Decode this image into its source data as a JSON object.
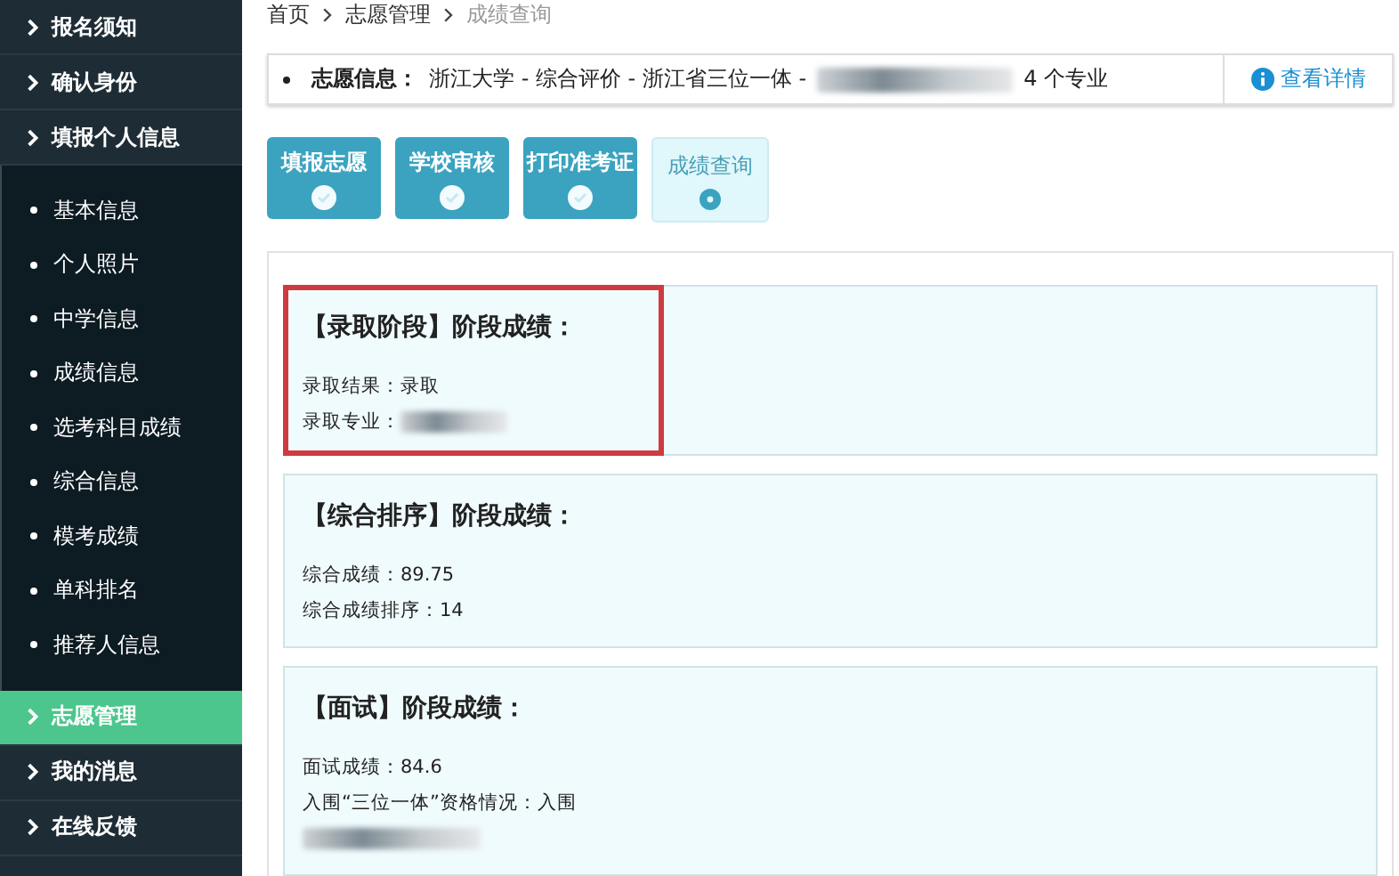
{
  "sidebar": {
    "items": [
      {
        "label": "报名须知",
        "kind": "section",
        "selected": false
      },
      {
        "label": "确认身份",
        "kind": "section",
        "selected": false
      },
      {
        "label": "填报个人信息",
        "kind": "section",
        "selected": false,
        "expanded": true,
        "children": [
          {
            "label": "基本信息"
          },
          {
            "label": "个人照片"
          },
          {
            "label": "中学信息"
          },
          {
            "label": "成绩信息"
          },
          {
            "label": "选考科目成绩"
          },
          {
            "label": "综合信息"
          },
          {
            "label": "模考成绩"
          },
          {
            "label": "单科排名"
          },
          {
            "label": "推荐人信息"
          }
        ]
      },
      {
        "label": "志愿管理",
        "kind": "section",
        "selected": true
      },
      {
        "label": "我的消息",
        "kind": "section",
        "selected": false
      },
      {
        "label": "在线反馈",
        "kind": "section",
        "selected": false
      }
    ]
  },
  "breadcrumb": [
    {
      "label": "首页",
      "current": false
    },
    {
      "label": "志愿管理",
      "current": false
    },
    {
      "label": "成绩查询",
      "current": true
    }
  ],
  "info": {
    "label": "志愿信息：",
    "value": "浙江大学 - 综合评价 - 浙江省三位一体 -",
    "redacted": true,
    "suffix": "4 个专业",
    "link": "查看详情"
  },
  "steps": [
    {
      "label": "填报志愿",
      "selected": false
    },
    {
      "label": "学校审核",
      "selected": false
    },
    {
      "label": "打印准考证",
      "selected": false
    },
    {
      "label": "成绩查询",
      "selected": true
    }
  ],
  "cards": [
    {
      "title": "【录取阶段】阶段成绩：",
      "highlighted": true,
      "rows": [
        {
          "kind": "field",
          "label": "录取结果：",
          "value": "录取"
        },
        {
          "kind": "redacted",
          "label": "录取专业："
        }
      ]
    },
    {
      "title": "【综合排序】阶段成绩：",
      "highlighted": false,
      "rows": [
        {
          "kind": "field",
          "label": "综合成绩：",
          "value": "89.75"
        },
        {
          "kind": "field",
          "label": "综合成绩排序：",
          "value": "14"
        }
      ]
    },
    {
      "title": "【面试】阶段成绩：",
      "highlighted": false,
      "rows": [
        {
          "kind": "field",
          "label": "面试成绩：",
          "value": "84.6"
        },
        {
          "kind": "field",
          "label": "入围“三位一体”资格情况：",
          "value": "入围"
        },
        {
          "kind": "redacted"
        }
      ]
    }
  ]
}
